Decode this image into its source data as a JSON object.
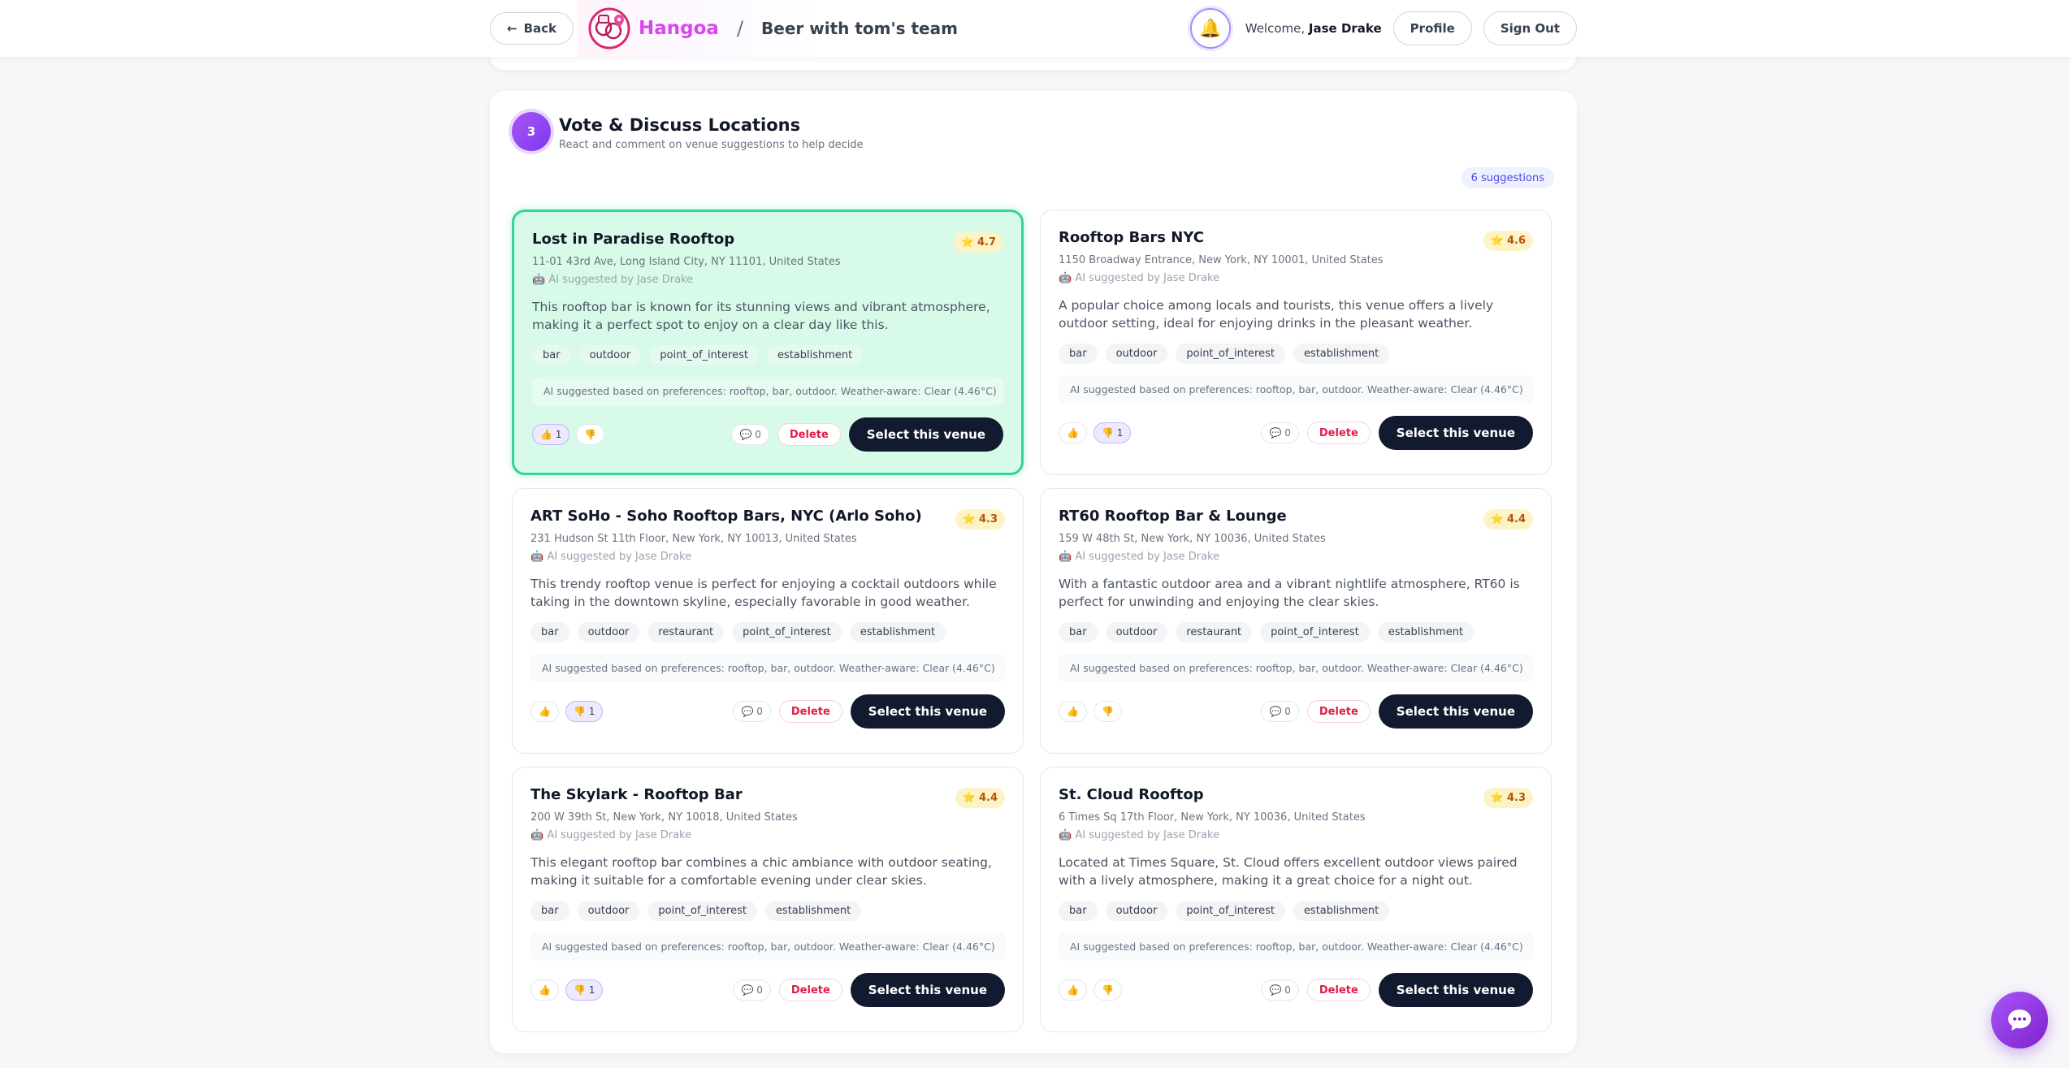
{
  "header": {
    "back_label": "Back",
    "brand": "Hangoa",
    "separator": "/",
    "event_title": "Beer with tom's team",
    "welcome_prefix": "Welcome,",
    "user_name": "Jase Drake",
    "profile_label": "Profile",
    "signout_label": "Sign Out"
  },
  "section": {
    "step": "3",
    "title": "Vote & Discuss Locations",
    "subtitle": "React and comment on venue suggestions to help decide",
    "count_label": "6 suggestions"
  },
  "colors": {
    "brand": "#d946ef",
    "accent_purple": "#7c3aed",
    "selected_bg": "#d7fbe8",
    "selected_border": "#34d399",
    "primary_button": "#111a2e",
    "delete_red": "#e11d48",
    "rating_bg": "#fef3c7"
  },
  "venues": [
    {
      "name": "Lost in Paradise Rooftop",
      "rating": "4.7",
      "address": "11-01 43rd Ave, Long Island City, NY 11101, United States",
      "suggested_by": "🤖 AI suggested by Jase Drake",
      "description": "This rooftop bar is known for its stunning views and vibrant atmosphere, making it a perfect spot to enjoy on a clear day like this.",
      "tags": [
        "bar",
        "outdoor",
        "point_of_interest",
        "establishment"
      ],
      "ai_note": "AI suggested based on preferences: rooftop, bar, outdoor. Weather-aware: Clear (4.46°C)",
      "thumbs_up": "👍 1",
      "thumbs_down": "👎",
      "comments": "💬 0",
      "delete_label": "Delete",
      "select_label": "Select this venue"
    },
    {
      "name": "Rooftop Bars NYC",
      "rating": "4.6",
      "address": "1150 Broadway Entrance, New York, NY 10001, United States",
      "suggested_by": "🤖 AI suggested by Jase Drake",
      "description": "A popular choice among locals and tourists, this venue offers a lively outdoor setting, ideal for enjoying drinks in the pleasant weather.",
      "tags": [
        "bar",
        "outdoor",
        "point_of_interest",
        "establishment"
      ],
      "ai_note": "AI suggested based on preferences: rooftop, bar, outdoor. Weather-aware: Clear (4.46°C)",
      "thumbs_up": "👍",
      "thumbs_down": "👎 1",
      "comments": "💬 0",
      "delete_label": "Delete",
      "select_label": "Select this venue"
    },
    {
      "name": "ART SoHo - Soho Rooftop Bars, NYC (Arlo Soho)",
      "rating": "4.3",
      "address": "231 Hudson St 11th Floor, New York, NY 10013, United States",
      "suggested_by": "🤖 AI suggested by Jase Drake",
      "description": "This trendy rooftop venue is perfect for enjoying a cocktail outdoors while taking in the downtown skyline, especially favorable in good weather.",
      "tags": [
        "bar",
        "outdoor",
        "restaurant",
        "point_of_interest",
        "establishment"
      ],
      "ai_note": "AI suggested based on preferences: rooftop, bar, outdoor. Weather-aware: Clear (4.46°C)",
      "thumbs_up": "👍",
      "thumbs_down": "👎 1",
      "comments": "💬 0",
      "delete_label": "Delete",
      "select_label": "Select this venue"
    },
    {
      "name": "RT60 Rooftop Bar & Lounge",
      "rating": "4.4",
      "address": "159 W 48th St, New York, NY 10036, United States",
      "suggested_by": "🤖 AI suggested by Jase Drake",
      "description": "With a fantastic outdoor area and a vibrant nightlife atmosphere, RT60 is perfect for unwinding and enjoying the clear skies.",
      "tags": [
        "bar",
        "outdoor",
        "restaurant",
        "point_of_interest",
        "establishment"
      ],
      "ai_note": "AI suggested based on preferences: rooftop, bar, outdoor. Weather-aware: Clear (4.46°C)",
      "thumbs_up": "👍",
      "thumbs_down": "👎",
      "comments": "💬 0",
      "delete_label": "Delete",
      "select_label": "Select this venue"
    },
    {
      "name": "The Skylark - Rooftop Bar",
      "rating": "4.4",
      "address": "200 W 39th St, New York, NY 10018, United States",
      "suggested_by": "🤖 AI suggested by Jase Drake",
      "description": "This elegant rooftop bar combines a chic ambiance with outdoor seating, making it suitable for a comfortable evening under clear skies.",
      "tags": [
        "bar",
        "outdoor",
        "point_of_interest",
        "establishment"
      ],
      "ai_note": "AI suggested based on preferences: rooftop, bar, outdoor. Weather-aware: Clear (4.46°C)",
      "thumbs_up": "👍",
      "thumbs_down": "👎 1",
      "comments": "💬 0",
      "delete_label": "Delete",
      "select_label": "Select this venue"
    },
    {
      "name": "St. Cloud Rooftop",
      "rating": "4.3",
      "address": "6 Times Sq 17th Floor, New York, NY 10036, United States",
      "suggested_by": "🤖 AI suggested by Jase Drake",
      "description": "Located at Times Square, St. Cloud offers excellent outdoor views paired with a lively atmosphere, making it a great choice for a night out.",
      "tags": [
        "bar",
        "outdoor",
        "point_of_interest",
        "establishment"
      ],
      "ai_note": "AI suggested based on preferences: rooftop, bar, outdoor. Weather-aware: Clear (4.46°C)",
      "thumbs_up": "👍",
      "thumbs_down": "👎",
      "comments": "💬 0",
      "delete_label": "Delete",
      "select_label": "Select this venue"
    }
  ]
}
